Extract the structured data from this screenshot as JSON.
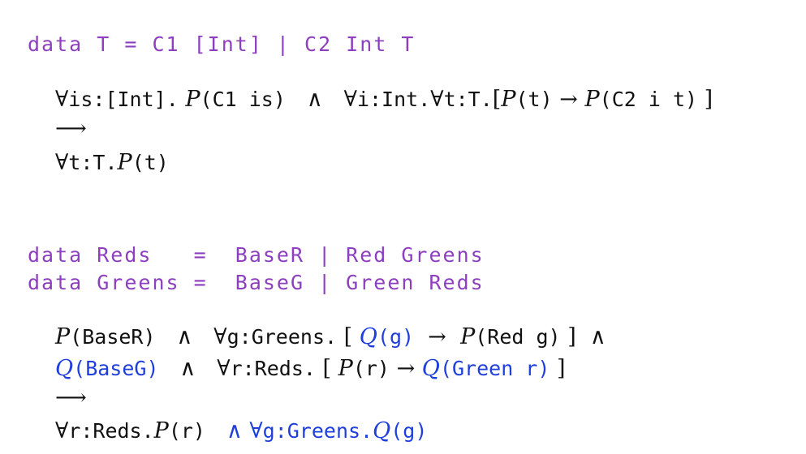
{
  "block1": {
    "decl": "data T = C1 [Int] | C2 Int T",
    "l1a_forall": "∀",
    "l1a_bind": "is:[Int].",
    "l1a_P": "P",
    "l1a_arg": "(C1 is)",
    "and": "∧",
    "l1b_forall": "∀",
    "l1b_bind": "i:Int.",
    "l1b_forall2": "∀",
    "l1b_bind2": "t:T.",
    "l1b_open": "[",
    "l1b_P1": "P",
    "l1b_arg1": "(t)",
    "arrow": "→",
    "l1b_P2": "P",
    "l1b_arg2": "(C2 i t)",
    "l1b_close": "]",
    "implies": "⟶",
    "l3_forall": "∀",
    "l3_bind": "t:T.",
    "l3_P": "P",
    "l3_arg": "(t)"
  },
  "block2": {
    "decl1": "data Reds   =  BaseR | Red Greens",
    "decl2": "data Greens =  BaseG | Green Reds",
    "r1": {
      "P": "P",
      "arg": "(BaseR)",
      "and": "∧",
      "forall": "∀",
      "bind": "g:Greens.",
      "open": "[",
      "Q": "Q",
      "qarg": "(g)",
      "arrow": "→",
      "P2": "P",
      "parg2": "(Red g)",
      "close": "]",
      "and2": "∧"
    },
    "r2": {
      "Q": "Q",
      "arg": "(BaseG)",
      "and": "∧",
      "forall": "∀",
      "bind": "r:Reds.",
      "open": "[",
      "P": "P",
      "parg": "(r)",
      "arrow": "→",
      "Q2": "Q",
      "qarg2": "(Green r)",
      "close": "]"
    },
    "implies": "⟶",
    "r4": {
      "forall": "∀",
      "bind": "r:Reds.",
      "P": "P",
      "parg": "(r)",
      "and": "∧",
      "forall2": "∀",
      "bind2": "g:Greens.",
      "Q": "Q",
      "qarg": "(g)"
    }
  }
}
